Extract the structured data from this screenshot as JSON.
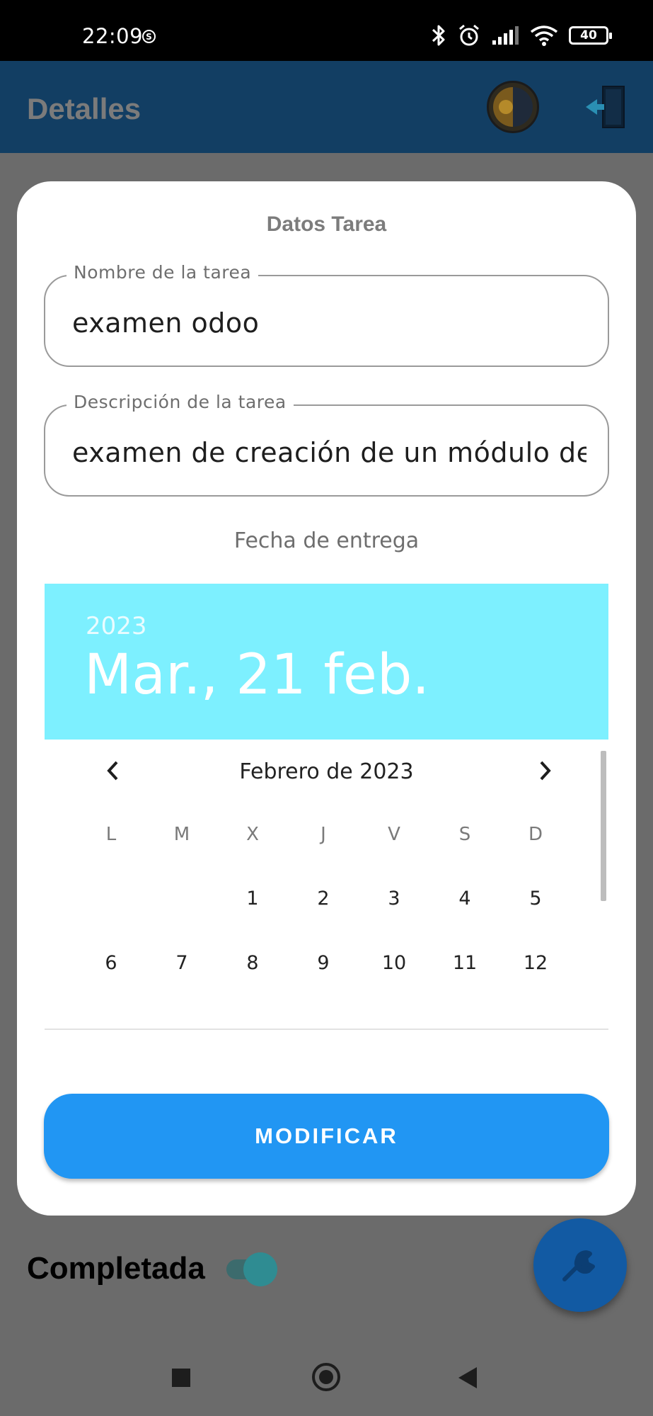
{
  "status_bar": {
    "time": "22:09",
    "s_badge": "S",
    "battery": "40"
  },
  "app_bar": {
    "title": "Detalles"
  },
  "dialog": {
    "title": "Datos Tarea",
    "name_field": {
      "label": "Nombre de la tarea",
      "value": "examen odoo"
    },
    "description_field": {
      "label": "Descripción de la tarea",
      "value": "examen de creación de un módulo de"
    },
    "date_caption": "Fecha de entrega",
    "date_picker": {
      "year": "2023",
      "selected_date": "Mar., 21 feb.",
      "month_label": "Febrero de 2023",
      "weekdays": [
        "L",
        "M",
        "X",
        "J",
        "V",
        "S",
        "D"
      ],
      "week1": [
        "",
        "",
        "1",
        "2",
        "3",
        "4",
        "5"
      ],
      "week2": [
        "6",
        "7",
        "8",
        "9",
        "10",
        "11",
        "12"
      ]
    },
    "modify_button": "MODIFICAR"
  },
  "page": {
    "completed_label": "Completada"
  },
  "colors": {
    "header_bg": "#7df0ff",
    "button_bg": "#2196f3",
    "app_bar": "#123e63",
    "fab": "#125aa3"
  }
}
